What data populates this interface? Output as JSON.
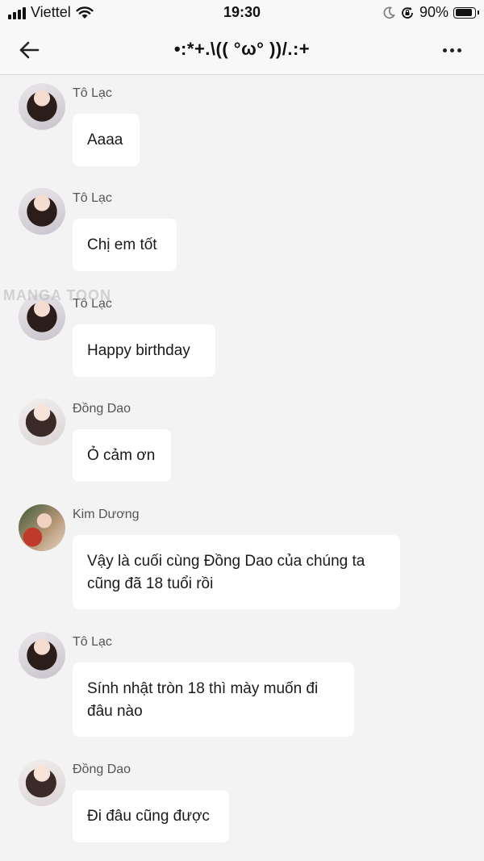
{
  "status_bar": {
    "carrier": "Viettel",
    "time": "19:30",
    "battery": "90%",
    "battery_level": 0.9,
    "icons": [
      "signal-icon",
      "wifi-icon",
      "moon-icon",
      "rotation-lock-icon",
      "battery-icon"
    ]
  },
  "header": {
    "title": "•:*+.\\(( °ω° ))/.:+",
    "back_icon": "back-arrow-icon",
    "more_icon": "more-icon"
  },
  "watermark": "MANGA TOON",
  "messages": [
    {
      "sender": "Tô Lạc",
      "lines": [
        "Aaaa"
      ],
      "avatar": "to-lac"
    },
    {
      "sender": "Tô Lạc",
      "lines": [
        "Chị em tốt"
      ],
      "avatar": "to-lac"
    },
    {
      "sender": "Tô Lạc",
      "lines": [
        "Happy birthday"
      ],
      "avatar": "to-lac"
    },
    {
      "sender": "Đồng Dao",
      "lines": [
        "Ỏ cảm ơn"
      ],
      "avatar": "dong-dao"
    },
    {
      "sender": "Kim Dương",
      "lines": [
        "Vậy là cuối cùng Đồng Dao của chúng ta",
        "cũng đã 18 tuổi rồi"
      ],
      "avatar": "kim-duong"
    },
    {
      "sender": "Tô Lạc",
      "lines": [
        "Sính nhật tròn 18 thì mày muốn đi",
        "đâu nào"
      ],
      "avatar": "to-lac"
    },
    {
      "sender": "Đồng Dao",
      "lines": [
        "Đi đâu cũng được"
      ],
      "avatar": "dong-dao"
    }
  ]
}
